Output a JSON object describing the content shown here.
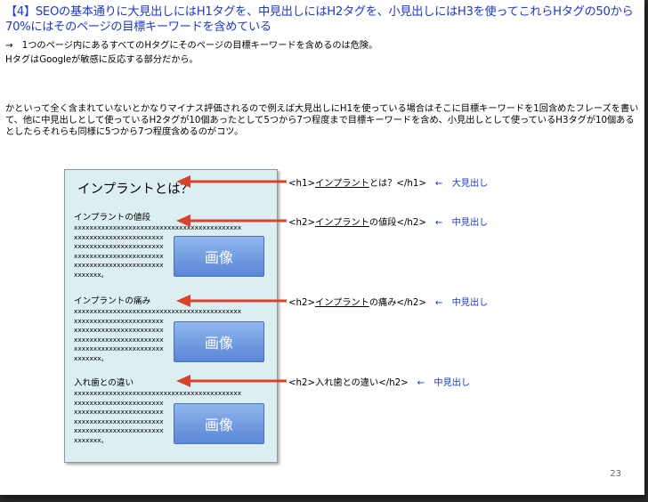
{
  "title": "【4】SEOの基本通りに大見出しにはH1タグを、中見出しにはH2タグを、小見出しにはH3を使ってこれらHタグの50から70%にはそのページの目標キーワードを含めている",
  "line1": "→　1つのページ内にあるすべてのHタグにそのページの目標キーワードを含めるのは危険。",
  "line2": "HタグはGoogleが敏感に反応する部分だから。",
  "paragraph": "かといって全く含まれていないとかなりマイナス評価されるので例えば大見出しにH1を使っている場合はそこに目標キーワードを1回含めたフレーズを書いて、他に中見出しとして使っているH2タグが10個あったとして5つから7つ程度まで目標キーワードを含め、小見出しとして使っているH3タグが10個あるとしたらそれらも同様に5つから7つ程度含めるのがコツ。",
  "mock": {
    "h1": "インプラントとは？",
    "image_label": "画像",
    "x_full": "xxxxxxxxxxxxxxxxxxxxxxxxxxxxxxxxxxxxxxxxxxx",
    "x_short": "xxxxxxxxxxxxxxxxxxxxxxx",
    "x_end": "xxxxxxx。",
    "sections": [
      {
        "heading": "インプラントの値段"
      },
      {
        "heading": "インプラントの痛み"
      },
      {
        "heading": "入れ歯との違い"
      }
    ]
  },
  "tags": [
    {
      "prefix": "<h1>",
      "keyword": "インプラント",
      "rest": "とは？</h1>",
      "note": "←　大見出し"
    },
    {
      "prefix": "<h2>",
      "keyword": "インプラント",
      "rest": "の値段</h2>",
      "note": "←　中見出し"
    },
    {
      "prefix": "<h2>",
      "keyword": "インプラント",
      "rest": "の痛み</h2>",
      "note": "←　中見出し"
    },
    {
      "prefix": "<h2>",
      "keyword": "",
      "rest": "入れ歯との違い</h2>",
      "note": "←　中見出し"
    }
  ],
  "page_number": "23",
  "colors": {
    "accent_blue": "#1a36e6",
    "arrow_red": "#d9432b",
    "mock_bg": "#dbeff3"
  }
}
